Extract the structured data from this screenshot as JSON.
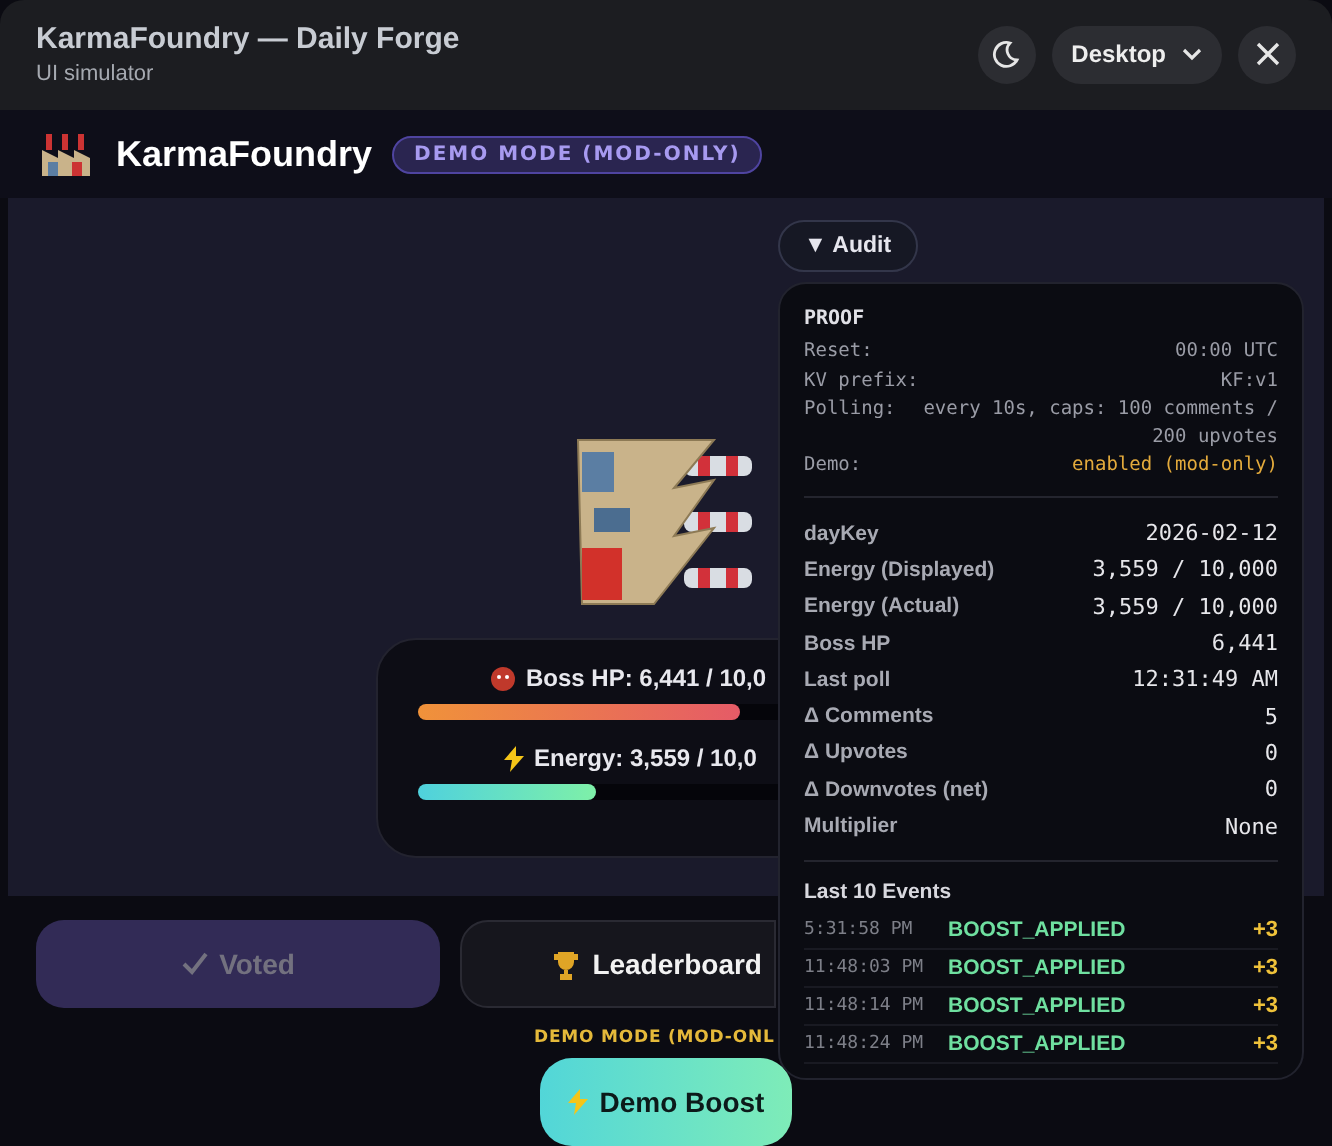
{
  "window": {
    "title": "KarmaFoundry — Daily Forge",
    "subtitle": "UI simulator"
  },
  "header_controls": {
    "device": "Desktop"
  },
  "brand": {
    "name": "KarmaFoundry",
    "badge": "DEMO MODE (MOD-ONLY)"
  },
  "stats": [
    {
      "kind": "boss",
      "label": "Boss HP: 6,441 / 10,0",
      "level": 0.6441
    },
    {
      "kind": "energy",
      "label": "Energy: 3,559 / 10,0",
      "level": 0.3559
    }
  ],
  "actions": [
    {
      "kind": "voted",
      "label": "Voted",
      "disabled": true
    },
    {
      "kind": "leaderboard",
      "label": "Leaderboard",
      "disabled": false
    }
  ],
  "demo": {
    "label": "DEMO MODE (MOD-ONL",
    "button": "Demo Boost"
  },
  "audit": {
    "toggle": "▼ Audit",
    "expanded": true,
    "proof_title": "PROOF",
    "proof": [
      {
        "label": "Reset:",
        "value": "00:00 UTC",
        "highlight": false
      },
      {
        "label": "KV prefix:",
        "value": "KF:v1",
        "highlight": false
      },
      {
        "label": "Polling:",
        "value": "every 10s, caps: 100 comments / 200 upvotes",
        "highlight": false
      },
      {
        "label": "Demo:",
        "value": "enabled (mod-only)",
        "highlight": true
      }
    ],
    "rows": [
      {
        "label": "dayKey",
        "value": "2026-02-12"
      },
      {
        "label": "Energy (Displayed)",
        "value": "3,559 / 10,000"
      },
      {
        "label": "Energy (Actual)",
        "value": "3,559 / 10,000"
      },
      {
        "label": "Boss HP",
        "value": "6,441"
      },
      {
        "label": "Last poll",
        "value": "12:31:49 AM"
      },
      {
        "label": "Δ Comments",
        "value": "5"
      },
      {
        "label": "Δ Upvotes",
        "value": "0"
      },
      {
        "label": "Δ Downvotes (net)",
        "value": "0"
      },
      {
        "label": "Multiplier",
        "value": "None"
      }
    ],
    "events_title": "Last 10 Events",
    "events": [
      {
        "time": "5:31:58 PM",
        "type": "BOOST_APPLIED",
        "delta": "+3"
      },
      {
        "time": "11:48:03 PM",
        "type": "BOOST_APPLIED",
        "delta": "+3"
      },
      {
        "time": "11:48:14 PM",
        "type": "BOOST_APPLIED",
        "delta": "+3"
      },
      {
        "time": "11:48:24 PM",
        "type": "BOOST_APPLIED",
        "delta": "+3"
      }
    ]
  }
}
